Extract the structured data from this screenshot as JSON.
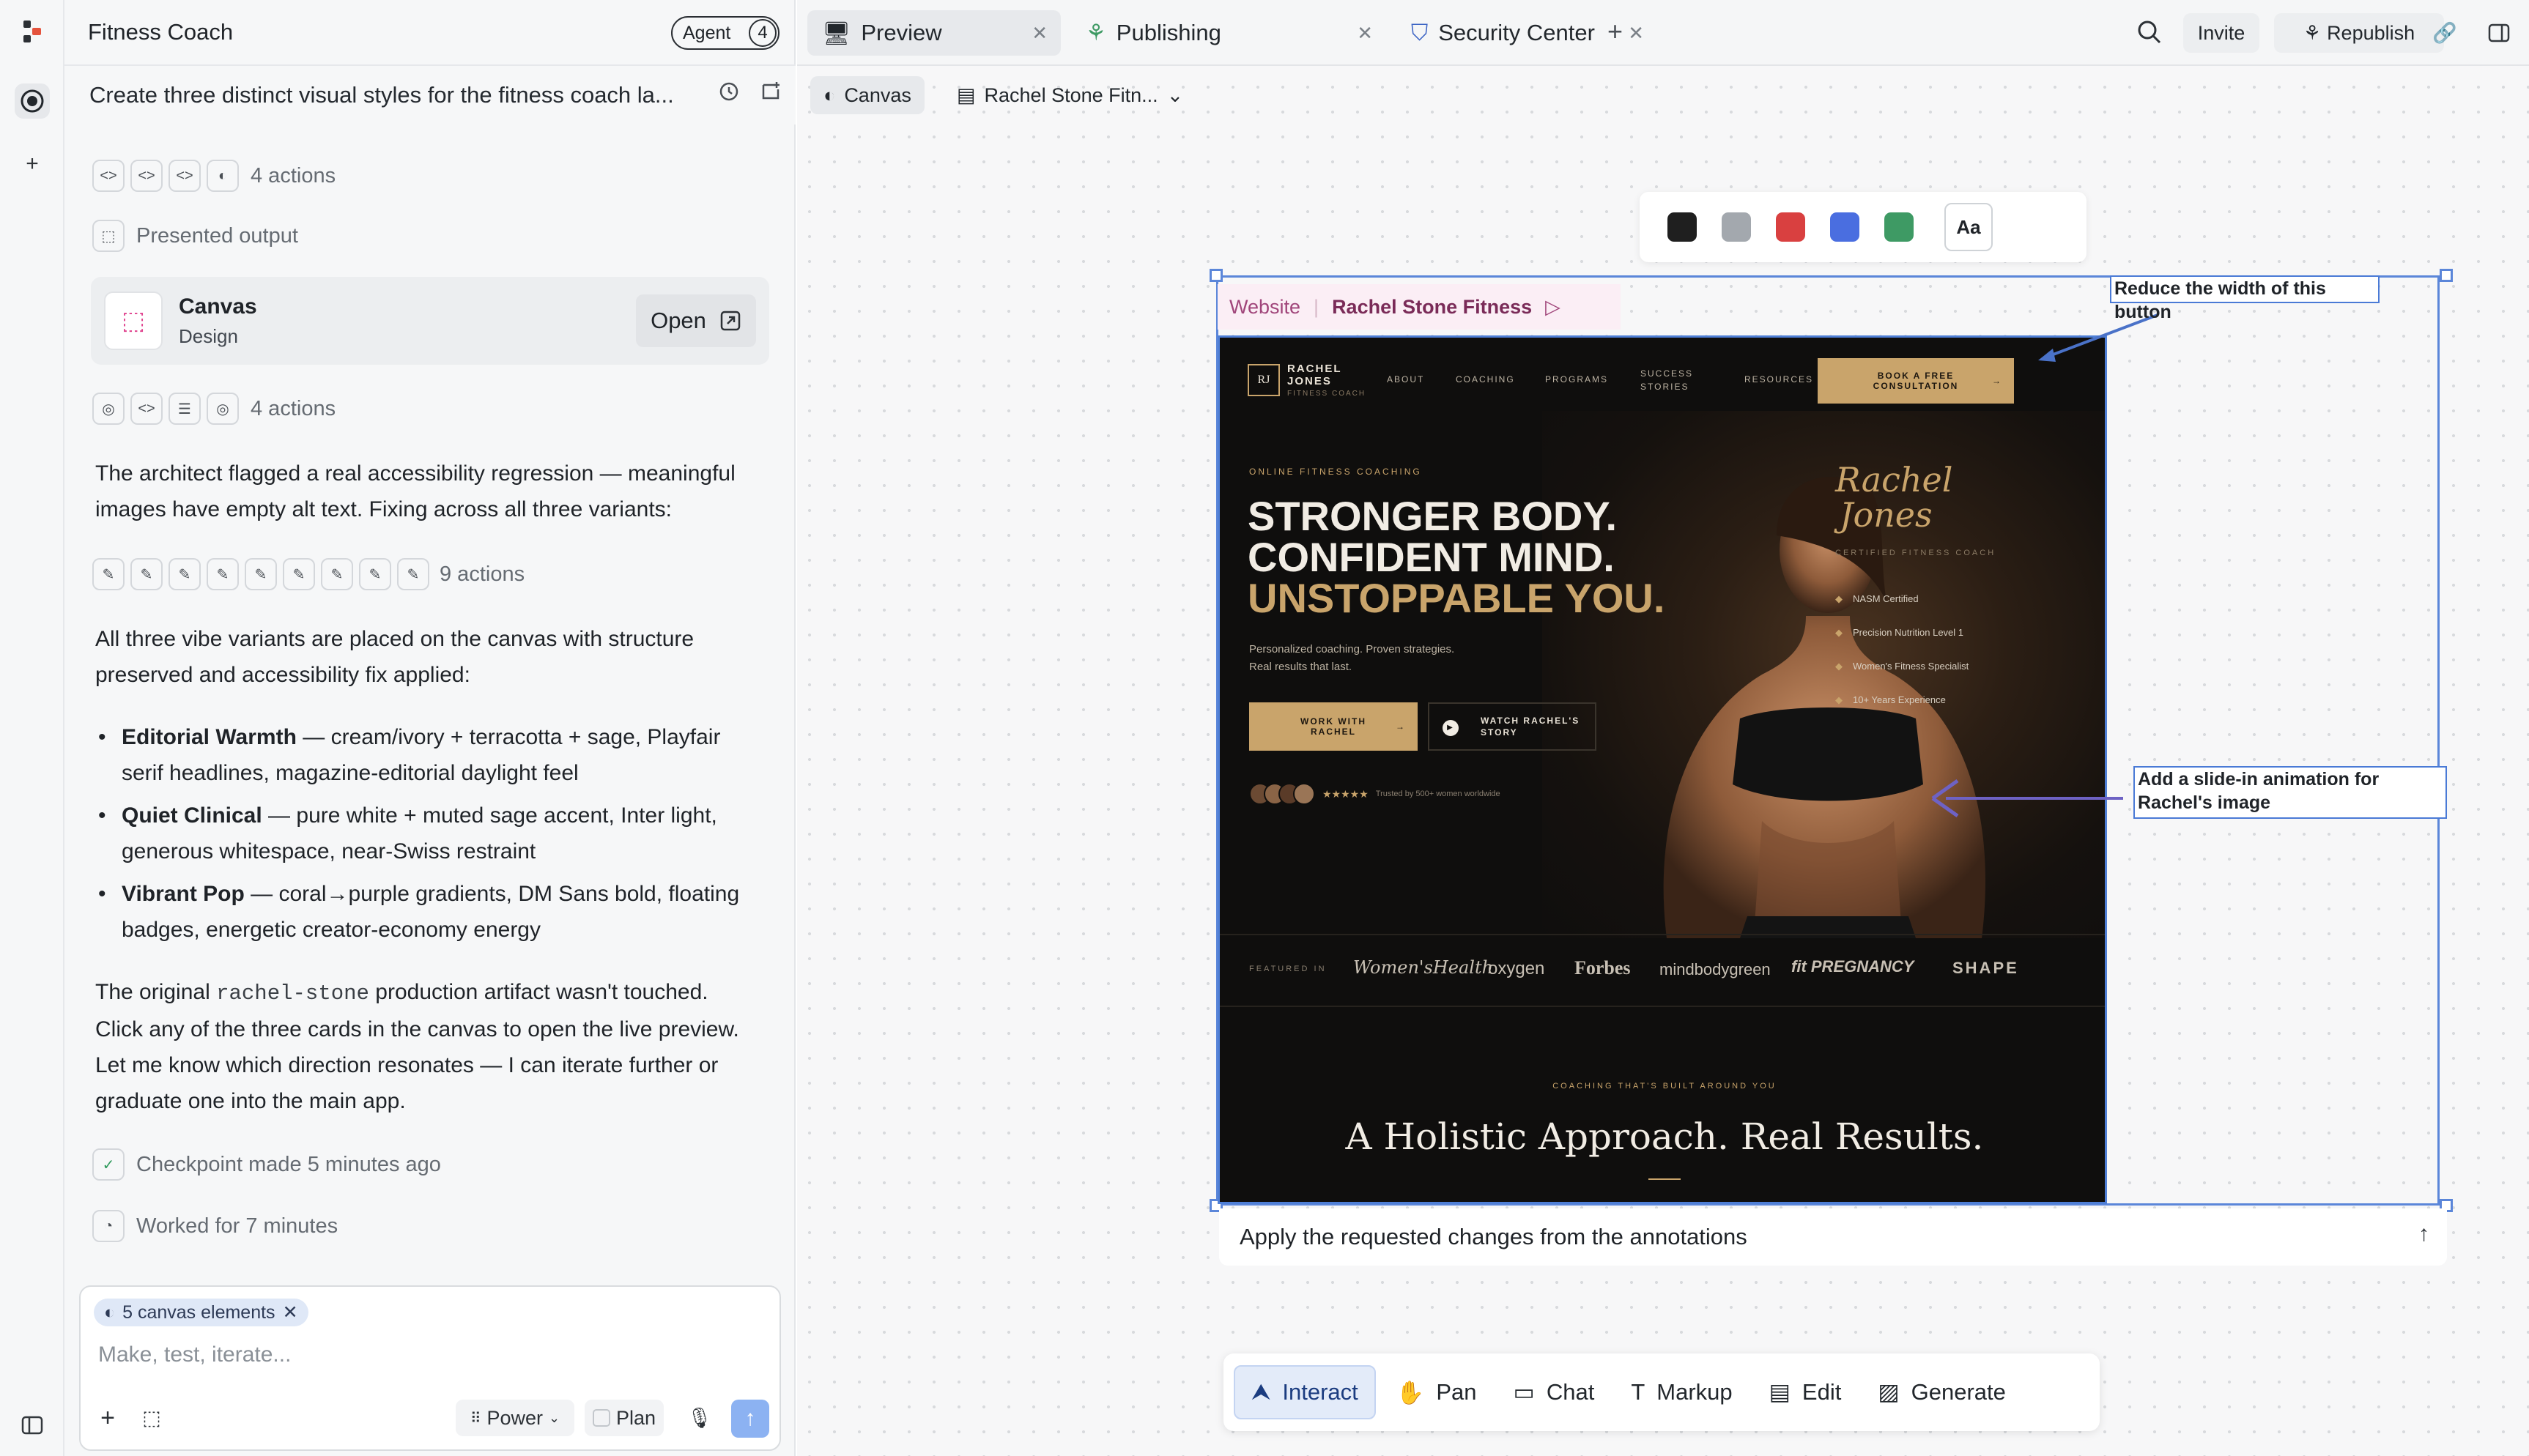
{
  "app": {
    "title": "Fitness Coach",
    "agent_label": "Agent",
    "agent_count": "4"
  },
  "thread": {
    "title": "Create three distinct visual styles for the fitness coach la...",
    "steps": [
      {
        "label": "4 actions"
      },
      {
        "label": "Presented output"
      }
    ],
    "canvas_card": {
      "title": "Canvas",
      "subtitle": "Design",
      "open_label": "Open"
    },
    "steps2_label": "4 actions",
    "para1": "The architect flagged a real accessibility regression — meaningful images have empty alt text. Fixing across all three variants:",
    "steps3_label": "9 actions",
    "para2": "All three vibe variants are placed on the canvas with structure preserved and accessibility fix applied:",
    "bullets": [
      {
        "name": "Editorial Warmth",
        "text": " — cream/ivory + terracotta + sage, Playfair serif headlines, magazine-editorial daylight feel"
      },
      {
        "name": "Quiet Clinical",
        "text": " — pure white + muted sage accent, Inter light, generous whitespace, near-Swiss restraint"
      },
      {
        "name": "Vibrant Pop",
        "text": " — coral→purple gradients, DM Sans bold, floating badges, energetic creator-economy energy"
      }
    ],
    "para3_before": "The original ",
    "para3_code": "rachel-stone",
    "para3_after": " production artifact wasn't touched. Click any of the three cards in the canvas to open the live preview. Let me know which direction resonates — I can iterate further or graduate one into the main app.",
    "checkpoint": "Checkpoint made 5 minutes ago",
    "worked": "Worked for 7 minutes"
  },
  "composer": {
    "chip": "5 canvas elements",
    "placeholder": "Make, test, iterate...",
    "mode": "Power",
    "plan": "Plan"
  },
  "tabs": [
    {
      "label": "Preview"
    },
    {
      "label": "Publishing"
    },
    {
      "label": "Security Center"
    }
  ],
  "topright": {
    "invite": "Invite",
    "republish": "Republish"
  },
  "subbar": {
    "canvas": "Canvas",
    "doc": "Rachel Stone Fitn..."
  },
  "colors": {
    "swatches": [
      "#1f1f1f",
      "#a3a8ae",
      "#d94040",
      "#4a6ee0",
      "#3e9a64"
    ],
    "aa": "Aa"
  },
  "canvas_frame": {
    "type": "Website",
    "name": "Rachel Stone Fitness"
  },
  "site": {
    "logo_mark": "RJ",
    "logo_name1": "RACHEL",
    "logo_name2": "JONES",
    "logo_sub": "FITNESS COACH",
    "nav": [
      "ABOUT",
      "COACHING",
      "PROGRAMS",
      "SUCCESS STORIES",
      "RESOURCES"
    ],
    "cta": "BOOK A FREE CONSULTATION",
    "eyebrow": "ONLINE FITNESS COACHING",
    "h1": "STRONGER BODY.",
    "h2": "CONFIDENT MIND.",
    "h3": "UNSTOPPABLE YOU.",
    "sub1": "Personalized coaching. Proven strategies.",
    "sub2": "Real results that last.",
    "btn1": "WORK WITH RACHEL",
    "btn2": "WATCH RACHEL'S STORY",
    "trust": "Trusted by 500+ women worldwide",
    "stars": "★★★★★",
    "script1": "Rachel",
    "script2": "Jones",
    "cert_title": "CERTIFIED FITNESS COACH",
    "certs": [
      "NASM Certified",
      "Precision Nutrition Level 1",
      "Women's Fitness Specialist",
      "10+ Years Experience"
    ],
    "featured_label": "FEATURED IN",
    "press": [
      "Women'sHealth",
      "oxygen",
      "Forbes",
      "mindbodygreen",
      "fit PREGNANCY",
      "SHAPE"
    ],
    "section_eyebrow": "COACHING THAT'S BUILT AROUND YOU",
    "section_title": "A Holistic Approach. Real Results."
  },
  "annotations": {
    "a1": "Reduce the width of this button",
    "a2": "Add a slide-in animation for Rachel's image"
  },
  "prompt": "Apply the requested changes from the annotations",
  "tools": [
    {
      "label": "Interact"
    },
    {
      "label": "Pan"
    },
    {
      "label": "Chat"
    },
    {
      "label": "Markup"
    },
    {
      "label": "Edit"
    },
    {
      "label": "Generate"
    }
  ]
}
